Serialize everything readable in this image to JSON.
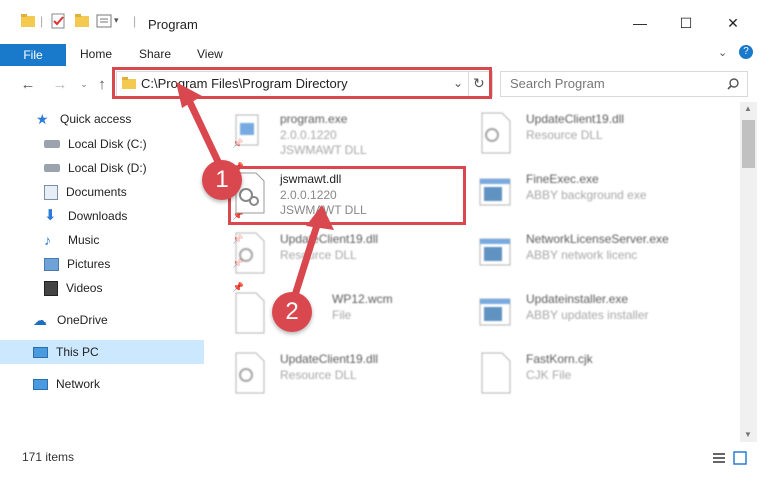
{
  "window": {
    "title": "Program",
    "minimize_glyph": "—",
    "maximize_glyph": "☐",
    "close_glyph": "✕"
  },
  "ribbon": {
    "tabs": [
      "File",
      "Home",
      "Share",
      "View"
    ]
  },
  "address": {
    "path": "C:\\Program Files\\Program Directory",
    "search_placeholder": "Search Program"
  },
  "sidebar": {
    "items": [
      {
        "label": "Quick access",
        "icon": "star-icon"
      },
      {
        "label": "Local Disk (C:)",
        "icon": "drive-icon"
      },
      {
        "label": "Local Disk (D:)",
        "icon": "drive-icon"
      },
      {
        "label": "Documents",
        "icon": "documents-icon"
      },
      {
        "label": "Downloads",
        "icon": "download-icon"
      },
      {
        "label": "Music",
        "icon": "music-icon"
      },
      {
        "label": "Pictures",
        "icon": "pictures-icon"
      },
      {
        "label": "Videos",
        "icon": "videos-icon"
      },
      {
        "label": "OneDrive",
        "icon": "cloud-icon"
      },
      {
        "label": "This PC",
        "icon": "computer-icon"
      },
      {
        "label": "Network",
        "icon": "network-icon"
      }
    ]
  },
  "files": [
    {
      "name": "program.exe",
      "line2": "2.0.0.1220",
      "line3": "JSWMAWT DLL"
    },
    {
      "name": "UpdateClient19.dll",
      "line2": "Resource DLL",
      "line3": ""
    },
    {
      "name": "jswmawt.dll",
      "line2": "2.0.0.1220",
      "line3": "JSWMAWT DLL"
    },
    {
      "name": "FineExec.exe",
      "line2": "ABBY background exe",
      "line3": ""
    },
    {
      "name": "UpdateClient19.dll",
      "line2": "Resource DLL",
      "line3": ""
    },
    {
      "name": "NetworkLicenseServer.exe",
      "line2": "ABBY network licenc",
      "line3": ""
    },
    {
      "name": "WP12.wcm",
      "line2": "File",
      "line3": ""
    },
    {
      "name": "Updateinstaller.exe",
      "line2": "ABBY updates installer",
      "line3": ""
    },
    {
      "name": "UpdateClient19.dll",
      "line2": "Resource DLL",
      "line3": ""
    },
    {
      "name": "FastKorn.cjk",
      "line2": "CJK File",
      "line3": ""
    }
  ],
  "status": {
    "count": "171 items"
  },
  "annotations": {
    "step1": "1",
    "step2": "2"
  },
  "colors": {
    "accent": "#1979ca",
    "annotation": "#d9484f",
    "selected_nav": "#cce8ff"
  }
}
